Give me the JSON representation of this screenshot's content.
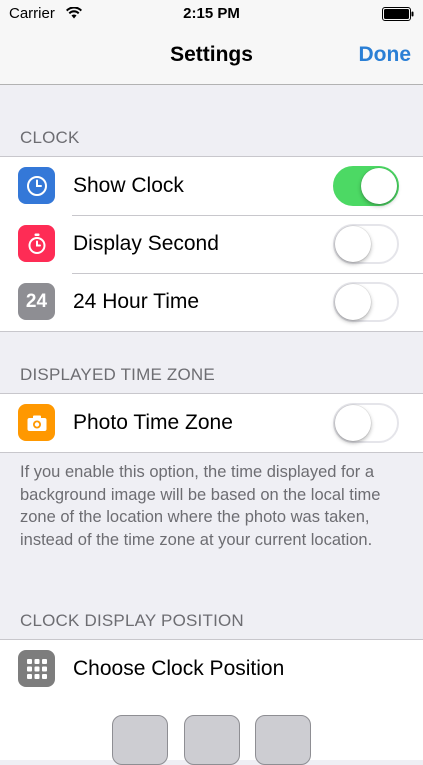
{
  "status_bar": {
    "carrier": "Carrier",
    "time": "2:15 PM"
  },
  "nav": {
    "title": "Settings",
    "done_label": "Done"
  },
  "sections": {
    "clock": {
      "header": "CLOCK",
      "rows": [
        {
          "label": "Show Clock",
          "icon": "clock-icon",
          "icon_color": "#3478d8",
          "toggle_on": true
        },
        {
          "label": "Display Second",
          "icon": "stopwatch-icon",
          "icon_color": "#fe2c55",
          "toggle_on": false
        },
        {
          "label": "24 Hour Time",
          "icon": "24-icon",
          "icon_text": "24",
          "icon_color": "#8e8e93",
          "toggle_on": false
        }
      ]
    },
    "time_zone": {
      "header": "DISPLAYED TIME ZONE",
      "rows": [
        {
          "label": "Photo Time Zone",
          "icon": "camera-icon",
          "icon_color": "#ff9800",
          "toggle_on": false
        }
      ],
      "footer": "If you enable this option, the time displayed for a background image will be based on the local time zone of the location where the photo was taken, instead of the time zone at your current location."
    },
    "position": {
      "header": "CLOCK DISPLAY POSITION",
      "rows": [
        {
          "label": "Choose Clock Position",
          "icon": "grid-icon",
          "icon_color": "#7d7d7d"
        }
      ]
    }
  },
  "colors": {
    "accent": "#2a7fd5",
    "toggle_on": "#4cd964"
  }
}
